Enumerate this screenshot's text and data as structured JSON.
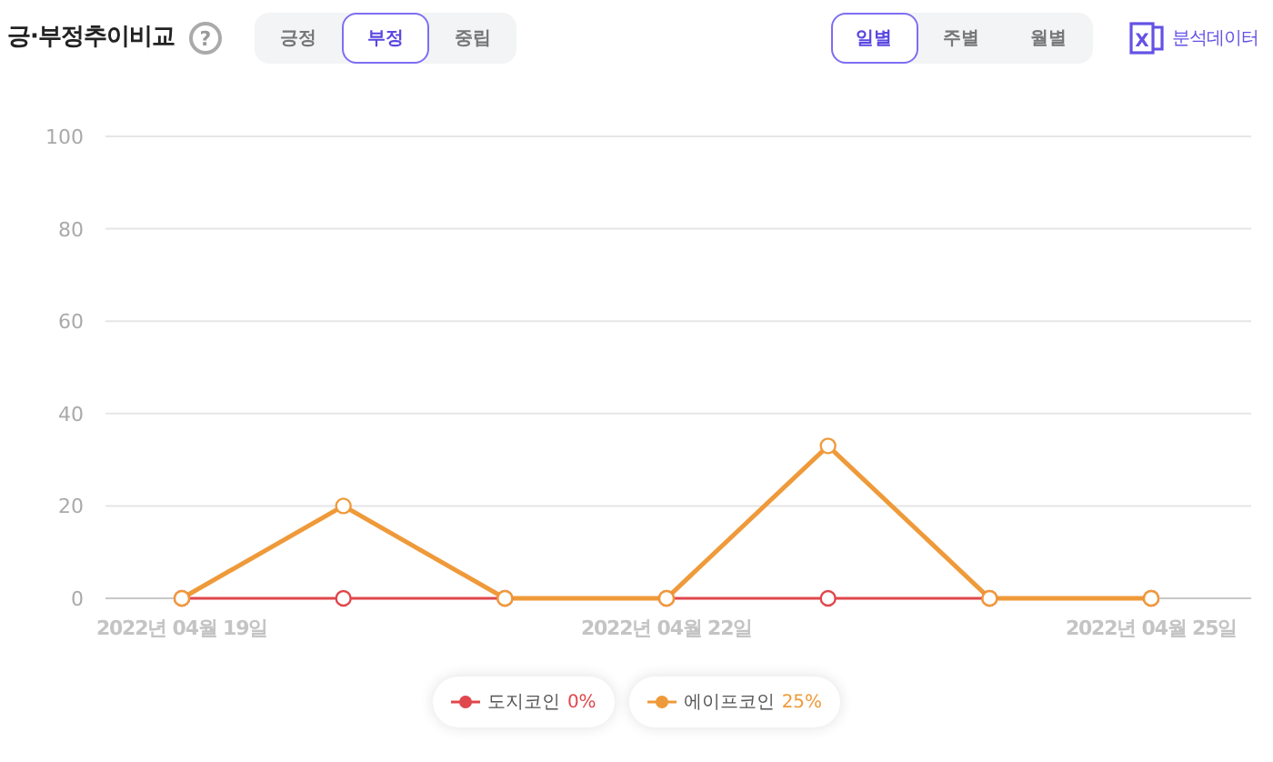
{
  "header": {
    "title": "긍·부정추이비교",
    "help": "?"
  },
  "sentiment_tabs": [
    {
      "label": "긍정",
      "selected": false
    },
    {
      "label": "부정",
      "selected": true
    },
    {
      "label": "중립",
      "selected": false
    }
  ],
  "period_tabs": [
    {
      "label": "일별",
      "selected": true
    },
    {
      "label": "주별",
      "selected": false
    },
    {
      "label": "월별",
      "selected": false
    }
  ],
  "export": {
    "icon_letter": "X",
    "label": "분석데이터"
  },
  "chart": {
    "chart_data": {
      "type": "line",
      "categories": [
        "2022년 04월 19일",
        null,
        null,
        "2022년 04월 22일",
        null,
        null,
        "2022년 04월 25일"
      ],
      "ylim": [
        0,
        100
      ],
      "grid": true,
      "yticks": [
        0,
        20,
        40,
        60,
        80,
        100
      ],
      "series": [
        {
          "name": "도지코인",
          "color": "#e0474c",
          "marker": "hollow-circle",
          "values": [
            0,
            0,
            0,
            0,
            0,
            0,
            0
          ]
        },
        {
          "name": "에이프코인",
          "color": "#ef9a3a",
          "marker": "hollow-circle",
          "values": [
            0,
            20,
            0,
            0,
            33,
            0,
            0
          ]
        }
      ]
    },
    "legend": [
      {
        "value": "0%"
      },
      {
        "value": "25%"
      }
    ]
  }
}
